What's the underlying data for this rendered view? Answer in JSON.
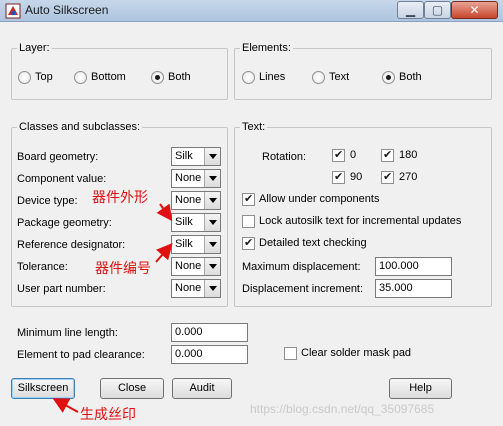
{
  "window": {
    "title": "Auto Silkscreen"
  },
  "layer": {
    "group_label": "Layer:",
    "options": [
      {
        "label": "Top",
        "checked": false
      },
      {
        "label": "Bottom",
        "checked": false
      },
      {
        "label": "Both",
        "checked": true
      }
    ]
  },
  "elements": {
    "group_label": "Elements:",
    "options": [
      {
        "label": "Lines",
        "checked": false
      },
      {
        "label": "Text",
        "checked": false
      },
      {
        "label": "Both",
        "checked": true
      }
    ]
  },
  "classes": {
    "group_label": "Classes and subclasses:",
    "rows": [
      {
        "label": "Board geometry:",
        "value": "Silk"
      },
      {
        "label": "Component value:",
        "value": "None"
      },
      {
        "label": "Device type:",
        "value": "None"
      },
      {
        "label": "Package geometry:",
        "value": "Silk"
      },
      {
        "label": "Reference designator:",
        "value": "Silk"
      },
      {
        "label": "Tolerance:",
        "value": "None"
      },
      {
        "label": "User part number:",
        "value": "None"
      }
    ]
  },
  "text": {
    "group_label": "Text:",
    "rotation_label": "Rotation:",
    "rotations": [
      {
        "label": "0",
        "checked": true
      },
      {
        "label": "180",
        "checked": true
      },
      {
        "label": "90",
        "checked": true
      },
      {
        "label": "270",
        "checked": true
      }
    ],
    "allow_under_components": {
      "label": "Allow under components",
      "checked": true
    },
    "lock_autosilk": {
      "label": "Lock autosilk text for incremental updates",
      "checked": false
    },
    "detailed_checking": {
      "label": "Detailed text checking",
      "checked": true
    },
    "max_displacement": {
      "label": "Maximum displacement:",
      "value": "100.000"
    },
    "displacement_increment": {
      "label": "Displacement increment:",
      "value": "35.000"
    }
  },
  "bottom": {
    "min_line_length": {
      "label": "Minimum line length:",
      "value": "0.000"
    },
    "element_to_pad": {
      "label": "Element to pad clearance:",
      "value": "0.000"
    },
    "clear_solder_mask": {
      "label": "Clear solder mask pad",
      "checked": false
    }
  },
  "buttons": {
    "silkscreen": "Silkscreen",
    "close": "Close",
    "audit": "Audit",
    "help": "Help"
  },
  "annotations": {
    "package_outline": "器件外形",
    "ref_designator": "器件编号",
    "generate_silk": "生成丝印",
    "color": "#e01010"
  },
  "watermark": "https://blog.csdn.net/qq_35097685"
}
